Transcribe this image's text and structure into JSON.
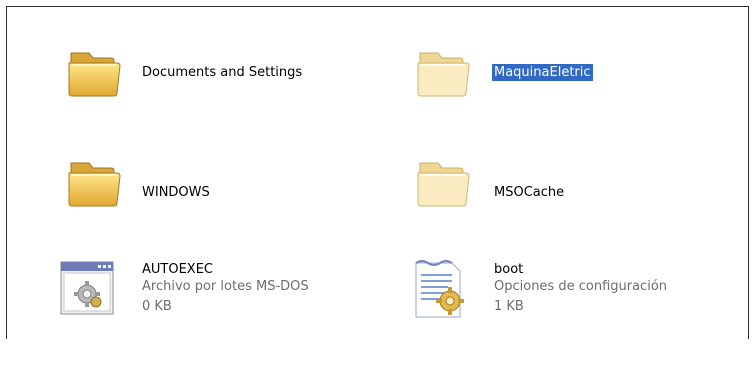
{
  "items": [
    {
      "name": "Documents and Settings",
      "kind": "folder",
      "selected": false
    },
    {
      "name": "MaquinaEletric",
      "kind": "folder-faded",
      "selected": true
    },
    {
      "name": "WINDOWS",
      "kind": "folder",
      "selected": false
    },
    {
      "name": "MSOCache",
      "kind": "folder-faded",
      "selected": false
    },
    {
      "name": "AUTOEXEC",
      "kind": "batch-file",
      "type": "Archivo por lotes MS-DOS",
      "size": "0 KB"
    },
    {
      "name": "boot",
      "kind": "config-file",
      "type": "Opciones de configuración",
      "size": "1 KB"
    }
  ],
  "colors": {
    "selection": "#316ac5",
    "folder_dark": "#e3b64a",
    "folder_light": "#f7e6a6"
  }
}
